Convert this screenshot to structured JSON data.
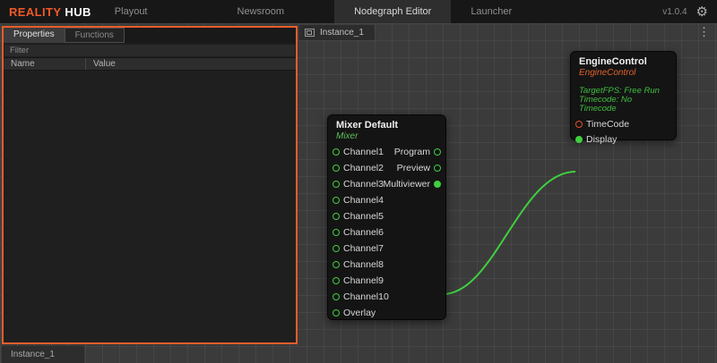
{
  "topbar": {
    "brand": {
      "reality": "REALITY",
      "hub": "HUB"
    },
    "nav": [
      {
        "label": "Playout",
        "active": false
      },
      {
        "label": "Newsroom",
        "active": false
      },
      {
        "label": "Nodegraph Editor",
        "active": true
      },
      {
        "label": "Launcher",
        "active": false
      }
    ],
    "version": "v1.0.4"
  },
  "icons": {
    "gear": "⚙",
    "kebab": "⋮"
  },
  "left_panel": {
    "tabs": [
      {
        "label": "Properties",
        "active": true
      },
      {
        "label": "Functions",
        "active": false
      }
    ],
    "filter_placeholder": "Filter",
    "columns": {
      "name": "Name",
      "value": "Value"
    },
    "rows": []
  },
  "canvas": {
    "instance_tab": {
      "label": "Instance_1"
    },
    "bottom_tab": {
      "label": "Instance_1"
    }
  },
  "nodes": {
    "mixer": {
      "title": "Mixer Default",
      "subtitle": "Mixer",
      "inputs": [
        "Channel1",
        "Channel2",
        "Channel3",
        "Channel4",
        "Channel5",
        "Channel6",
        "Channel7",
        "Channel8",
        "Channel9",
        "Channel10",
        "Overlay"
      ],
      "outputs": [
        {
          "label": "Program",
          "connected": false
        },
        {
          "label": "Preview",
          "connected": false
        },
        {
          "label": "Multiviewer",
          "connected": true
        }
      ]
    },
    "engine": {
      "title": "EngineControl",
      "subtitle": "EngineControl",
      "info": [
        "TargetFPS: Free Run",
        "Timecode: No Timecode"
      ],
      "ports": [
        {
          "label": "TimeCode",
          "color": "#e0502a",
          "connected": false
        },
        {
          "label": "Display",
          "color": "#3fcf3f",
          "connected": true
        }
      ]
    }
  },
  "connections": [
    {
      "from": "Mixer Default.Multiviewer",
      "to": "EngineControl.Display",
      "color": "#3fcf3f"
    }
  ],
  "colors": {
    "accent": "#e85d2a",
    "wire": "#3fcf3f",
    "port_green": "#3fcf3f",
    "port_orange": "#e0502a",
    "subtitle_green": "#5fbf5f",
    "subtitle_orange": "#e0622b"
  }
}
